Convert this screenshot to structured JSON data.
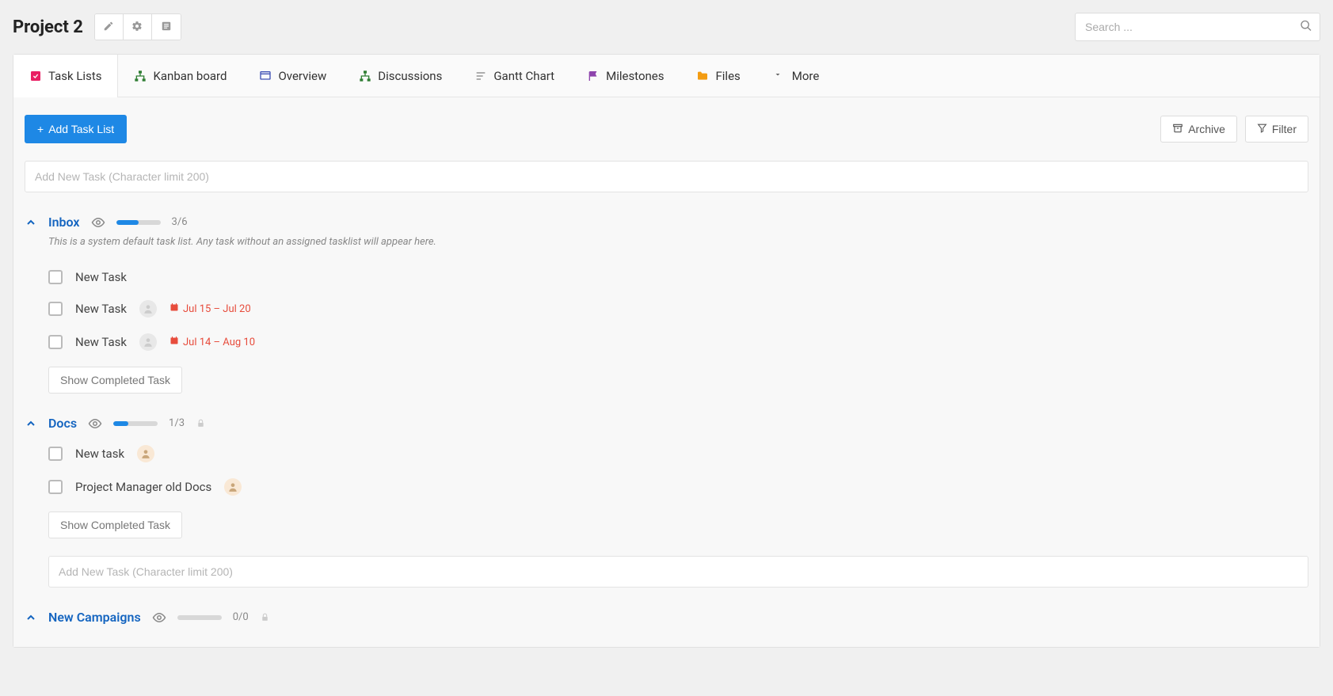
{
  "header": {
    "title": "Project 2",
    "search_placeholder": "Search ..."
  },
  "tabs": [
    {
      "label": "Task Lists",
      "icon": "check-square",
      "color": "#e91e63",
      "active": true
    },
    {
      "label": "Kanban board",
      "icon": "sitemap",
      "color": "#2e7d32"
    },
    {
      "label": "Overview",
      "icon": "window",
      "color": "#3f51b5"
    },
    {
      "label": "Discussions",
      "icon": "sitemap",
      "color": "#2e7d32"
    },
    {
      "label": "Gantt Chart",
      "icon": "bars",
      "color": "#888"
    },
    {
      "label": "Milestones",
      "icon": "flag",
      "color": "#8e44ad"
    },
    {
      "label": "Files",
      "icon": "folder",
      "color": "#f39c12"
    },
    {
      "label": "More",
      "icon": "caret-down",
      "color": "#666"
    }
  ],
  "toolbar": {
    "add_tasklist": "Add Task List",
    "archive": "Archive",
    "filter": "Filter"
  },
  "new_task_placeholder": "Add New Task (Character limit 200)",
  "lists": [
    {
      "title": "Inbox",
      "progress_done": 3,
      "progress_total": 6,
      "count_label": "3/6",
      "locked": false,
      "description": "This is a system default task list. Any task without an assigned tasklist will appear here.",
      "tasks": [
        {
          "title": "New Task",
          "avatar": null,
          "date": null
        },
        {
          "title": "New Task",
          "avatar": "gray",
          "date": "Jul 15 – Jul 20"
        },
        {
          "title": "New Task",
          "avatar": "gray",
          "date": "Jul 14 – Aug 10"
        }
      ],
      "show_completed": "Show Completed Task",
      "add_input": false
    },
    {
      "title": "Docs",
      "progress_done": 1,
      "progress_total": 3,
      "count_label": "1/3",
      "locked": true,
      "description": null,
      "tasks": [
        {
          "title": "New task",
          "avatar": "tan",
          "date": null
        },
        {
          "title": "Project Manager old Docs",
          "avatar": "tan",
          "date": null
        }
      ],
      "show_completed": "Show Completed Task",
      "add_input": true
    },
    {
      "title": "New Campaigns",
      "progress_done": 0,
      "progress_total": 0,
      "count_label": "0/0",
      "locked": true,
      "description": null,
      "tasks": [],
      "show_completed": null,
      "add_input": false
    }
  ]
}
